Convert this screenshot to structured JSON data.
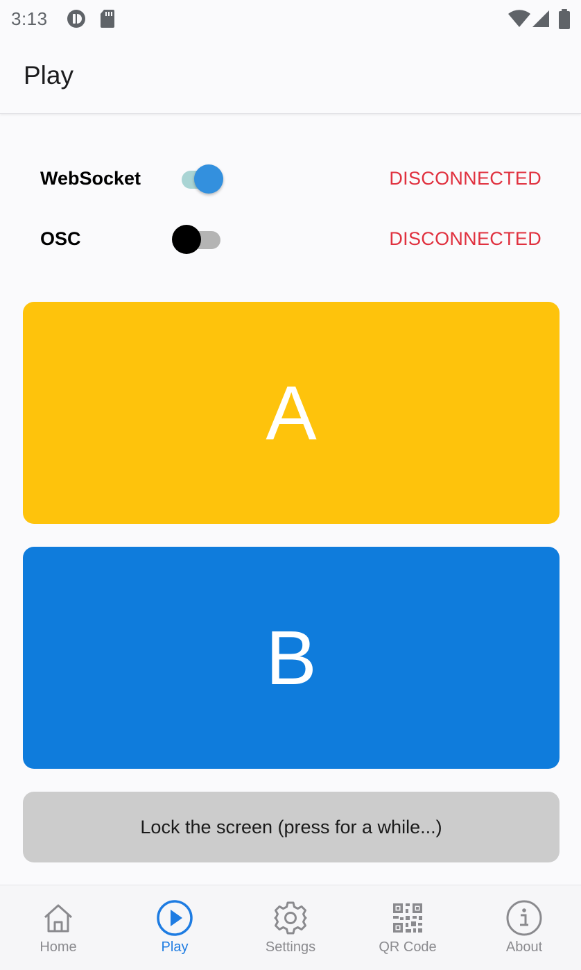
{
  "status_bar": {
    "time": "3:13",
    "icons": [
      "app-notification-icon",
      "sd-card-icon",
      "wifi-icon",
      "cell-signal-icon",
      "battery-icon"
    ]
  },
  "app_bar": {
    "title": "Play"
  },
  "connections": [
    {
      "label": "WebSocket",
      "enabled": true,
      "status": "DISCONNECTED"
    },
    {
      "label": "OSC",
      "enabled": false,
      "status": "DISCONNECTED"
    }
  ],
  "buttons": {
    "a": {
      "label": "A",
      "color": "#fec30c"
    },
    "b": {
      "label": "B",
      "color": "#0f7cdc"
    },
    "lock": {
      "label": "Lock the screen (press for a while...)"
    }
  },
  "bottom_nav": {
    "active": "Play",
    "items": [
      {
        "label": "Home",
        "icon": "home-icon"
      },
      {
        "label": "Play",
        "icon": "play-circle-icon"
      },
      {
        "label": "Settings",
        "icon": "gear-icon"
      },
      {
        "label": "QR Code",
        "icon": "qr-code-icon"
      },
      {
        "label": "About",
        "icon": "info-icon"
      }
    ]
  },
  "colors": {
    "status_disconnected": "#e0313f",
    "switch_on_thumb": "#3390de",
    "switch_on_track": "#a9d4d4",
    "active_nav": "#1e7ce2",
    "inactive_nav": "#8a8a8e"
  }
}
